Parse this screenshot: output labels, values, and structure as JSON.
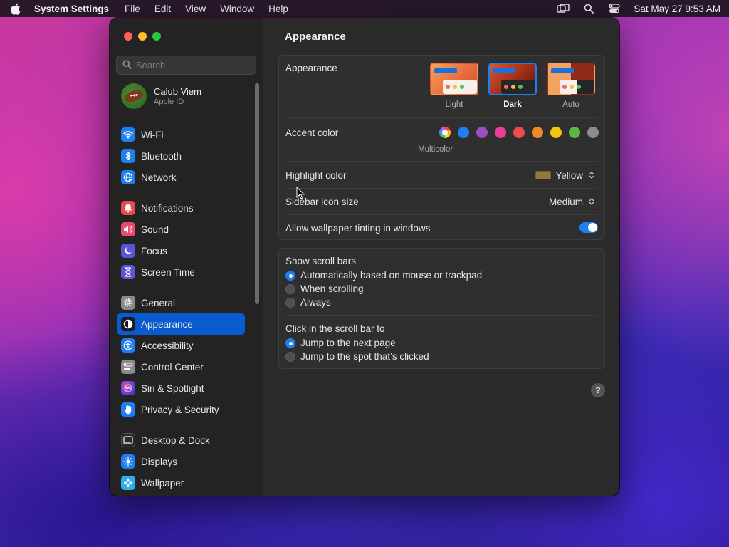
{
  "menubar": {
    "app_name": "System Settings",
    "menus": [
      "File",
      "Edit",
      "View",
      "Window",
      "Help"
    ],
    "datetime": "Sat May 27  9:53 AM"
  },
  "sidebar": {
    "search_placeholder": "Search",
    "profile": {
      "name": "Calub Viem",
      "subtitle": "Apple ID"
    },
    "groups": [
      [
        {
          "label": "Wi-Fi",
          "icon": "wifi-icon",
          "color": "#1f7ff0"
        },
        {
          "label": "Bluetooth",
          "icon": "bluetooth-icon",
          "color": "#1f7ff0"
        },
        {
          "label": "Network",
          "icon": "globe-icon",
          "color": "#1f7ff0"
        }
      ],
      [
        {
          "label": "Notifications",
          "icon": "bell-icon",
          "color": "#ea4b4b"
        },
        {
          "label": "Sound",
          "icon": "speaker-icon",
          "color": "#ea4b6b"
        },
        {
          "label": "Focus",
          "icon": "moon-icon",
          "color": "#5b55d6"
        },
        {
          "label": "Screen Time",
          "icon": "hourglass-icon",
          "color": "#5b55d6"
        }
      ],
      [
        {
          "label": "General",
          "icon": "gear-icon",
          "color": "#8a8a8a"
        },
        {
          "label": "Appearance",
          "icon": "appearance-icon",
          "color": "#1a1a1a",
          "selected": true
        },
        {
          "label": "Accessibility",
          "icon": "accessibility-icon",
          "color": "#1f7ff0"
        },
        {
          "label": "Control Center",
          "icon": "control-center-icon",
          "color": "#8a8a8a"
        },
        {
          "label": "Siri & Spotlight",
          "icon": "siri-icon",
          "color": "#6a3fd0"
        },
        {
          "label": "Privacy & Security",
          "icon": "hand-icon",
          "color": "#1f7ff0"
        }
      ],
      [
        {
          "label": "Desktop & Dock",
          "icon": "dock-icon",
          "color": "#2a2a2a"
        },
        {
          "label": "Displays",
          "icon": "sun-icon",
          "color": "#1f7ff0"
        },
        {
          "label": "Wallpaper",
          "icon": "wallpaper-icon",
          "color": "#2fb0e8"
        }
      ]
    ]
  },
  "content": {
    "title": "Appearance",
    "appearance": {
      "label": "Appearance",
      "modes": [
        {
          "label": "Light",
          "selected": false
        },
        {
          "label": "Dark",
          "selected": true
        },
        {
          "label": "Auto",
          "selected": false
        }
      ]
    },
    "accent": {
      "label": "Accent color",
      "multicolor_label": "Multicolor",
      "colors": [
        "multicolor",
        "#1f7ff0",
        "#9b4fc0",
        "#e6409a",
        "#ee4b4b",
        "#f28a24",
        "#f5c40f",
        "#5ab946",
        "#8c8c8c"
      ]
    },
    "highlight": {
      "label": "Highlight color",
      "value": "Yellow",
      "swatch": "#8f7a3a"
    },
    "icon_size": {
      "label": "Sidebar icon size",
      "value": "Medium"
    },
    "tinting": {
      "label": "Allow wallpaper tinting in windows",
      "on": true
    },
    "scroll_bars": {
      "label": "Show scroll bars",
      "options": [
        {
          "label": "Automatically based on mouse or trackpad",
          "selected": true
        },
        {
          "label": "When scrolling",
          "selected": false
        },
        {
          "label": "Always",
          "selected": false
        }
      ]
    },
    "click_scroll": {
      "label": "Click in the scroll bar to",
      "options": [
        {
          "label": "Jump to the next page",
          "selected": true
        },
        {
          "label": "Jump to the spot that’s clicked",
          "selected": false
        }
      ]
    },
    "help_label": "?"
  }
}
